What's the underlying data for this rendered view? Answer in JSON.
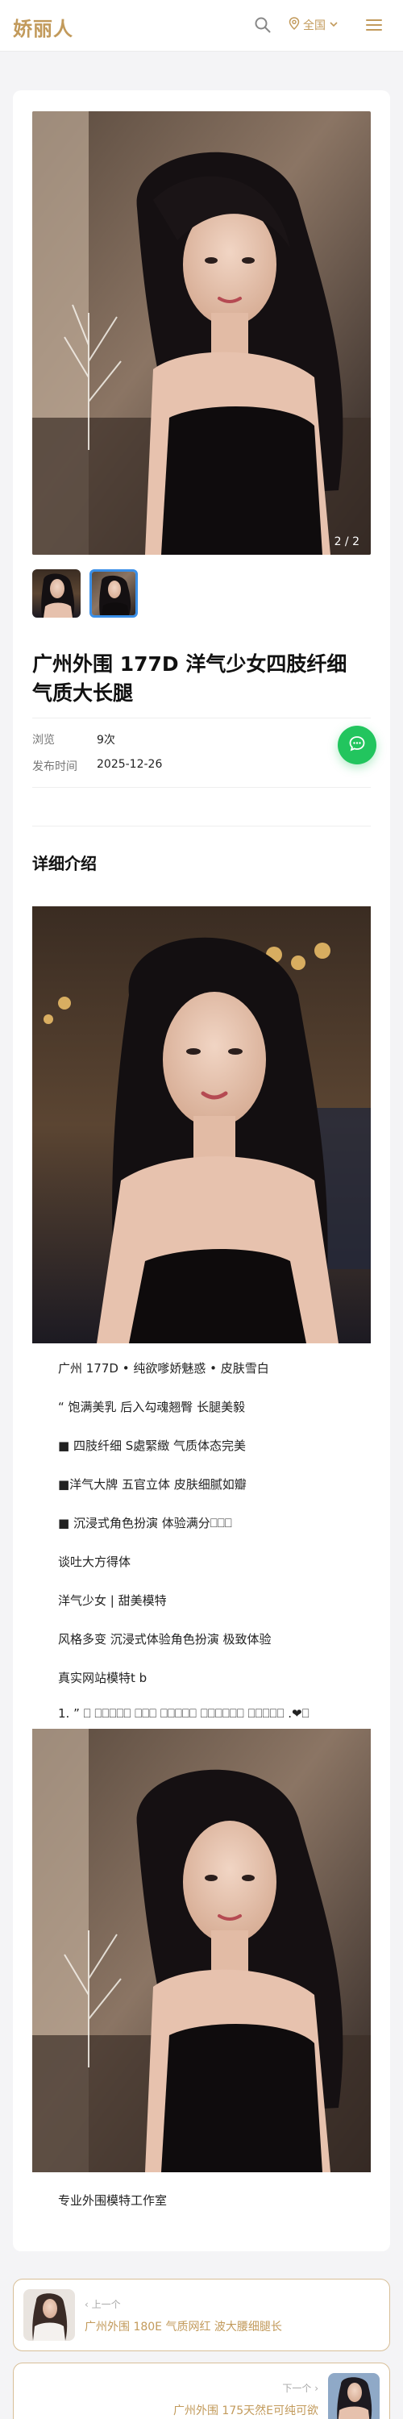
{
  "header": {
    "logo": "娇丽人",
    "region_label": "全国"
  },
  "gallery": {
    "counter": "2 / 2"
  },
  "post": {
    "title": "广州外围 177D 洋气少女四肢纤细 气质大长腿",
    "meta": [
      {
        "key": "浏览",
        "value": "9次"
      },
      {
        "key": "发布时间",
        "value": "2025-12-26"
      }
    ]
  },
  "detail": {
    "section_title": "详细介绍",
    "paragraphs": [
      "广州 177D • 纯欲嗲娇魅惑 • 皮肤雪白",
      "“    饱满美乳 后入勾魂翘臀 长腿美毅",
      "■ 四肢纤细 S處緊緻 气质体态完美",
      "■洋气大牌 五官立体  皮肤细腻如瓣",
      "■ 沉浸式角色扮演  体验满分⎕⎕⎕",
      "谈吐大方得体",
      "洋气少女 | 甜美模特",
      "风格多变 沉浸式体验角色扮演 极致体验",
      "真实网站模特t b",
      "1. ” ⎕ ⎕⎕⎕⎕⎕ ⎕⎕⎕ ⎕⎕⎕⎕⎕ ⎕⎕⎕⎕⎕⎕ ⎕⎕⎕⎕⎕ .❤⎕",
      "专业外围模特工作室"
    ]
  },
  "navigation": {
    "prev": {
      "label": "‹ 上一个",
      "title": "广州外围 180E 气质网红 波大腰细腿长"
    },
    "next": {
      "label": "下一个 ›",
      "title": "广州外围 175天然E可纯可欲"
    }
  },
  "icons": {
    "search": "search-icon",
    "location": "location-pin-icon",
    "chevron": "chevron-down-icon",
    "menu": "hamburger-menu-icon",
    "chat": "chat-bubble-icon"
  },
  "colors": {
    "accent": "#c29a5b",
    "chat": "#22c55e",
    "thumb_active": "#3a8fe8"
  }
}
